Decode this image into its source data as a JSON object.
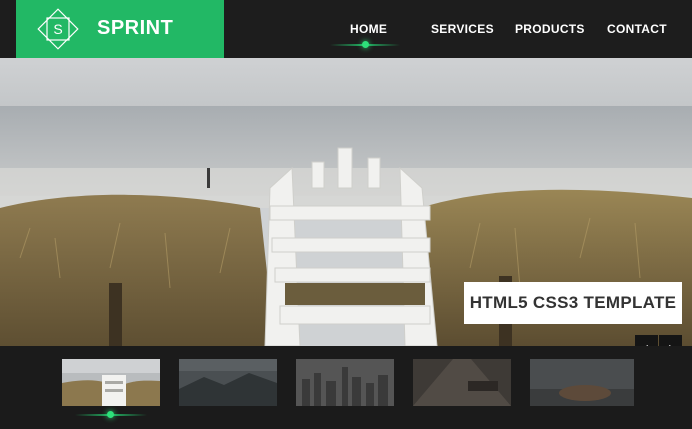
{
  "brand": {
    "logo_letter": "S",
    "name": "SPRINT",
    "accent": "#22b865"
  },
  "nav": {
    "items": [
      {
        "label": "HOME",
        "active": true
      },
      {
        "label": "SERVICES"
      },
      {
        "label": "PRODUCTS"
      },
      {
        "label": "CONTACT"
      }
    ]
  },
  "hero": {
    "caption": "HTML5 CSS3 TEMPLATE",
    "prev_icon": "chevron-left-icon",
    "next_icon": "chevron-right-icon",
    "prev_glyph": "‹",
    "next_glyph": "›"
  },
  "thumbnails": {
    "items": [
      {
        "subject": "beach-stairs",
        "active": true
      },
      {
        "subject": "misty-hills"
      },
      {
        "subject": "city-skyline"
      },
      {
        "subject": "railway-bench"
      },
      {
        "subject": "foggy-field"
      }
    ]
  }
}
